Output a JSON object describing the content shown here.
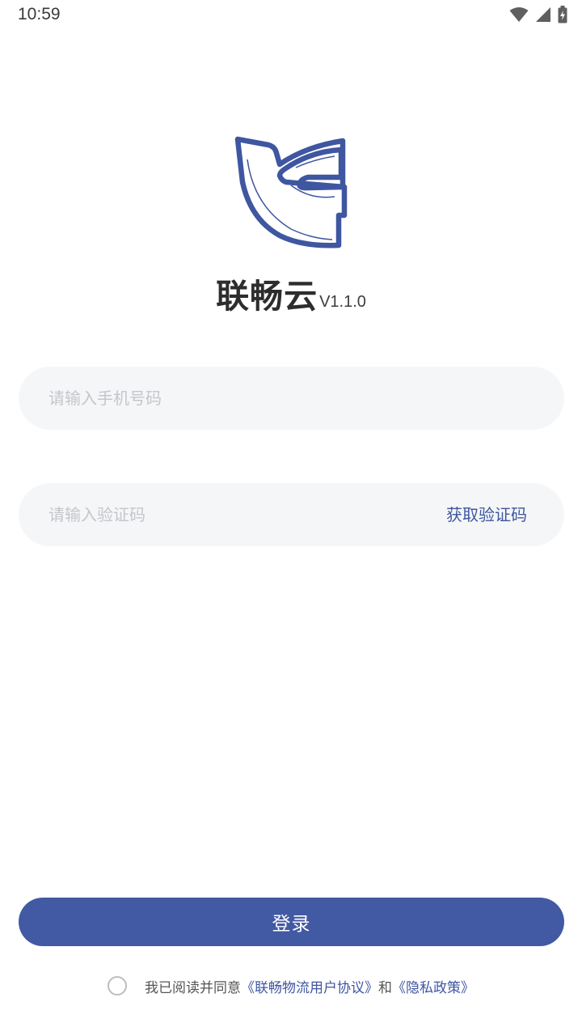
{
  "status_bar": {
    "time": "10:59",
    "icons": [
      "wifi-icon",
      "signal-icon",
      "battery-charging-icon"
    ]
  },
  "app": {
    "name": "联畅云",
    "version": "V1.1.0",
    "logo_icon": "lianchang-logo-icon",
    "accent_color": "#4259a3"
  },
  "form": {
    "phone_placeholder": "请输入手机号码",
    "phone_value": "",
    "code_placeholder": "请输入验证码",
    "code_value": "",
    "get_code_label": "获取验证码"
  },
  "login": {
    "button_label": "登录"
  },
  "agreement": {
    "prefix": "我已阅读并同意",
    "user_agreement": "《联畅物流用户协议》",
    "conjunction": "和",
    "privacy_policy": "《隐私政策》",
    "checked": false
  }
}
